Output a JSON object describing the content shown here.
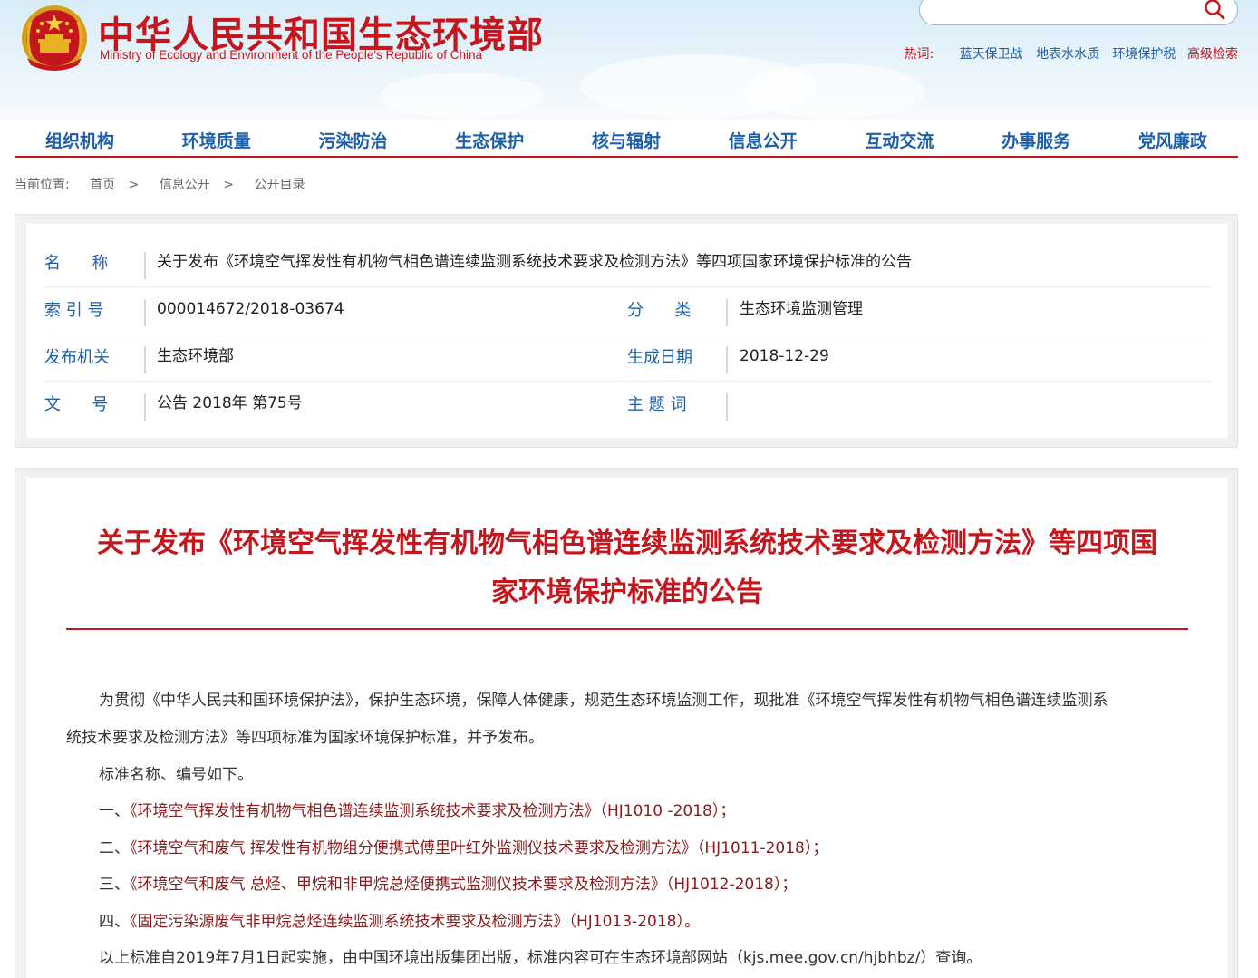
{
  "header": {
    "title_cn": "中华人民共和国生态环境部",
    "title_en": "Ministry of Ecology and Environment of the People's Republic of China",
    "search_placeholder": "",
    "hot_label": "热词:",
    "hot_words": [
      "蓝天保卫战",
      "地表水水质",
      "环境保护税"
    ],
    "advanced_search": "高级检索"
  },
  "nav": [
    "组织机构",
    "环境质量",
    "污染防治",
    "生态保护",
    "核与辐射",
    "信息公开",
    "互动交流",
    "办事服务",
    "党风廉政"
  ],
  "breadcrumb": {
    "label": "当前位置:",
    "items": [
      "首页",
      "信息公开",
      "公开目录"
    ],
    "separator": ">"
  },
  "meta": {
    "name_label": "名      称",
    "name_value": "关于发布《环境空气挥发性有机物气相色谱连续监测系统技术要求及检测方法》等四项国家环境保护标准的公告",
    "index_label": "索 引 号",
    "index_value": "000014672/2018-03674",
    "category_label": "分      类",
    "category_value": "生态环境监测管理",
    "publisher_label": "发布机关",
    "publisher_value": "生态环境部",
    "date_label": "生成日期",
    "date_value": "2018-12-29",
    "docno_label": "文      号",
    "docno_value": "公告 2018年 第75号",
    "keyword_label": "主 题 词",
    "keyword_value": ""
  },
  "article": {
    "title_line1": "关于发布《环境空气挥发性有机物气相色谱连续监测系统技术要求及检测方法》等四项国",
    "title_line2": "家环境保护标准的公告",
    "p1_line1": "为贯彻《中华人民共和国环境保护法》，保护生态环境，保障人体健康，规范生态环境监测工作，现批准《环境空气挥发性有机物气相色谱连续监测系",
    "p1_line2": "统技术要求及检测方法》等四项标准为国家环境保护标准，并予发布。",
    "p2": "标准名称、编号如下。",
    "standards": [
      {
        "num": "一、",
        "name": "《环境空气挥发性有机物气相色谱连续监测系统技术要求及检测方法》（HJ1010 -2018）；"
      },
      {
        "num": "二、",
        "name": "《环境空气和废气 挥发性有机物组分便携式傅里叶红外监测仪技术要求及检测方法》（HJ1011-2018）；"
      },
      {
        "num": "三、",
        "name": "《环境空气和废气 总烃、甲烷和非甲烷总烃便携式监测仪技术要求及检测方法》（HJ1012-2018）；"
      },
      {
        "num": "四、",
        "name": "《固定污染源废气非甲烷总烃连续监测系统技术要求及检测方法》（HJ1013-2018）。"
      }
    ],
    "p3": "以上标准自2019年7月1日起实施，由中国环境出版集团出版，标准内容可在生态环境部网站（kjs.mee.gov.cn/hjbhbz/）查询。"
  },
  "colors": {
    "brand_red": "#c4161c",
    "link_blue": "#1f5fa8",
    "standard_link": "#8b1a1a"
  },
  "icons": {
    "emblem": "national-emblem-icon",
    "search": "search-icon"
  }
}
